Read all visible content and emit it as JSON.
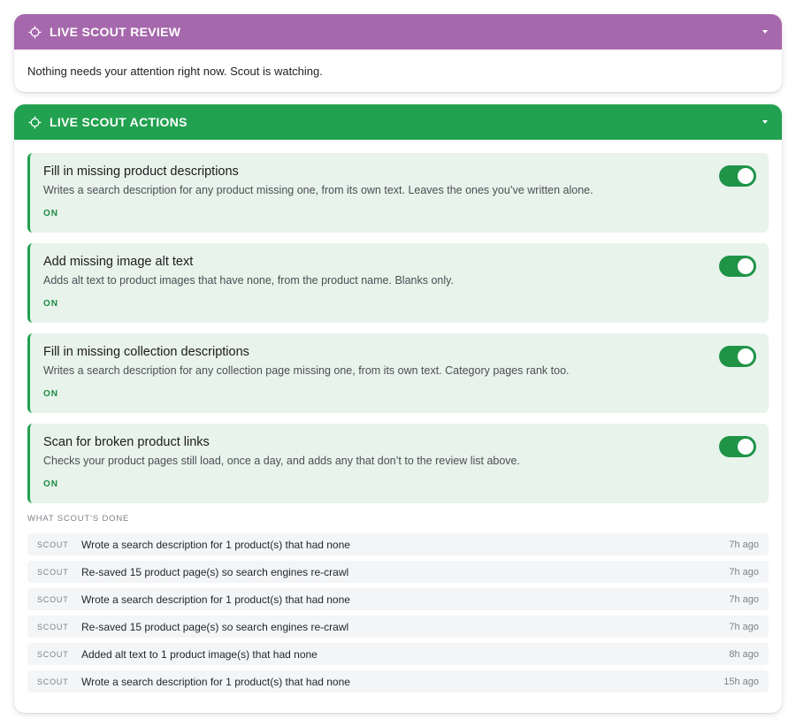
{
  "review": {
    "title": "LIVE SCOUT REVIEW",
    "message": "Nothing needs your attention right now. Scout is watching.",
    "header_color": "#a668ac",
    "icon": "crosshair-icon"
  },
  "actions": {
    "title": "LIVE SCOUT ACTIONS",
    "header_color": "#22a150",
    "icon": "crosshair-icon",
    "items": [
      {
        "title": "Fill in missing product descriptions",
        "description": "Writes a search description for any product missing one, from its own text. Leaves the ones you’ve written alone.",
        "status": "ON",
        "enabled": true
      },
      {
        "title": "Add missing image alt text",
        "description": "Adds alt text to product images that have none, from the product name. Blanks only.",
        "status": "ON",
        "enabled": true
      },
      {
        "title": "Fill in missing collection descriptions",
        "description": "Writes a search description for any collection page missing one, from its own text. Category pages rank too.",
        "status": "ON",
        "enabled": true
      },
      {
        "title": "Scan for broken product links",
        "description": "Checks your product pages still load, once a day, and adds any that don’t to the review list above.",
        "status": "ON",
        "enabled": true
      }
    ]
  },
  "history": {
    "heading": "WHAT SCOUT’S DONE",
    "rows": [
      {
        "who": "SCOUT",
        "what": "Wrote a search description for 1 product(s) that had none",
        "when": "7h ago"
      },
      {
        "who": "SCOUT",
        "what": "Re-saved 15 product page(s) so search engines re-crawl",
        "when": "7h ago"
      },
      {
        "who": "SCOUT",
        "what": "Wrote a search description for 1 product(s) that had none",
        "when": "7h ago"
      },
      {
        "who": "SCOUT",
        "what": "Re-saved 15 product page(s) so search engines re-crawl",
        "when": "7h ago"
      },
      {
        "who": "SCOUT",
        "what": "Added alt text to 1 product image(s) that had none",
        "when": "8h ago"
      },
      {
        "who": "SCOUT",
        "what": "Wrote a search description for 1 product(s) that had none",
        "when": "15h ago"
      }
    ]
  }
}
